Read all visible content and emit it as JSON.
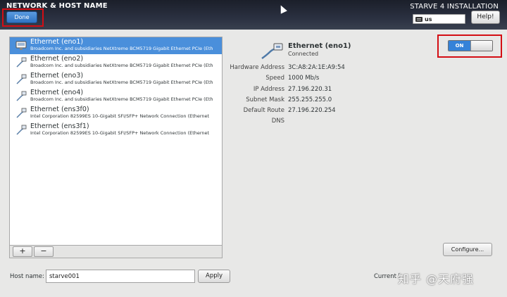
{
  "header": {
    "title": "NETWORK & HOST NAME",
    "install_title": "STARVE 4 INSTALLATION",
    "done_label": "Done",
    "keyboard_layout": "us",
    "help_label": "Help!"
  },
  "devices": [
    {
      "name": "Ethernet (eno1)",
      "description": "Broadcom Inc. and subsidiaries NetXtreme BCM5719 Gigabit Ethernet PCIe (Eth",
      "selected": true
    },
    {
      "name": "Ethernet (eno2)",
      "description": "Broadcom Inc. and subsidiaries NetXtreme BCM5719 Gigabit Ethernet PCIe (Eth",
      "selected": false
    },
    {
      "name": "Ethernet (eno3)",
      "description": "Broadcom Inc. and subsidiaries NetXtreme BCM5719 Gigabit Ethernet PCIe (Eth",
      "selected": false
    },
    {
      "name": "Ethernet (eno4)",
      "description": "Broadcom Inc. and subsidiaries NetXtreme BCM5719 Gigabit Ethernet PCIe (Eth",
      "selected": false
    },
    {
      "name": "Ethernet (ens3f0)",
      "description": "Intel Corporation 82599ES 10-Gigabit SFI/SFP+ Network Connection (Ethernet",
      "selected": false
    },
    {
      "name": "Ethernet (ens3f1)",
      "description": "Intel Corporation 82599ES 10-Gigabit SFI/SFP+ Network Connection (Ethernet",
      "selected": false
    }
  ],
  "list_toolbar": {
    "add_label": "+",
    "remove_label": "−"
  },
  "details": {
    "name": "Ethernet (eno1)",
    "status": "Connected",
    "rows": [
      {
        "label": "Hardware Address",
        "value": "3C:A8:2A:1E:A9:54"
      },
      {
        "label": "Speed",
        "value": "1000 Mb/s"
      },
      {
        "label": "IP Address",
        "value": "27.196.220.31"
      },
      {
        "label": "Subnet Mask",
        "value": "255.255.255.0"
      },
      {
        "label": "Default Route",
        "value": "27.196.220.254"
      },
      {
        "label": "DNS",
        "value": ""
      }
    ],
    "switch_label": "ON",
    "configure_label": "Configure..."
  },
  "footer": {
    "host_name_label": "Host name:",
    "host_name_value": "starve001",
    "apply_label": "Apply",
    "current_host_label": "Current h"
  },
  "watermark": "知乎 @天府强",
  "colors": {
    "accent": "#3582d8",
    "selected_row": "#4a8fdb",
    "highlight_box": "#d40e14"
  }
}
